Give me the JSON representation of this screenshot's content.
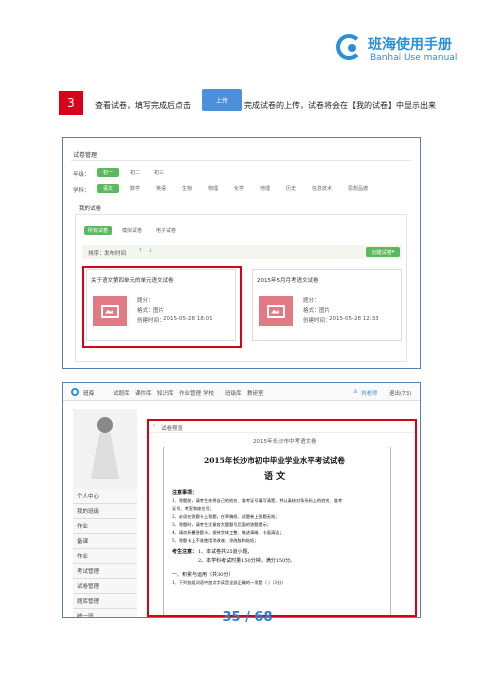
{
  "header": {
    "logo_cn": "班海使用手册",
    "logo_en": "Banhai Use manual"
  },
  "step": {
    "number": "3",
    "text_before": "查看试卷，填写完成后点击",
    "button_label": "上传",
    "text_after": "完成试卷的上传，试卷将会在【我的试卷】中显示出来"
  },
  "screenshot1": {
    "title": "试卷管理",
    "grade_label": "年级：",
    "grades": [
      "初一",
      "初二",
      "初三"
    ],
    "subject_label": "学科：",
    "subjects": [
      "语文",
      "数学",
      "英语",
      "生物",
      "物理",
      "化学",
      "地理",
      "历史",
      "信息技术",
      "思想品德"
    ],
    "section_label": "我的试卷",
    "tabs": [
      "所有试卷",
      "模拟试卷",
      "电子试卷"
    ],
    "sort_label": "排序：",
    "sort_value": "发布时间",
    "create_button": "创建试卷",
    "cards": [
      {
        "title": "关于语文第四单元的单元语文试卷",
        "score_label": "题分：",
        "format_label": "格式：",
        "format_value": "图片",
        "time_label": "创建时间：",
        "time_value": "2015-05-28 18:01"
      },
      {
        "title": "2015年5月月考语文试卷",
        "score_label": "题分：",
        "format_label": "格式：",
        "format_value": "图片",
        "time_label": "创建时间：",
        "time_value": "2015-05-28 12:33"
      }
    ]
  },
  "screenshot2": {
    "brand": "班海",
    "nav": [
      "试题库",
      "课件库",
      "知识库",
      "作业管理",
      "学校",
      "班级库",
      "教研室"
    ],
    "user": "刘老师",
    "logout": "退出(73)",
    "sidebar": [
      "个人中心",
      "我的班级",
      "作业",
      "备课",
      "作业",
      "考试管理",
      "试卷管理",
      "题库管理",
      "统一班"
    ],
    "breadcrumb": "试卷预览",
    "doc_header": "2015年长沙市中考语文卷",
    "doc_title": "2015年长沙市初中毕业学业水平考试试卷",
    "doc_subject": "语  文",
    "notice_title": "注意事项：",
    "notices": [
      "1、答题前，请考生先将自己的姓名、准考证号填写清楚，并认真核对条形码上的姓名、准考",
      "   证号、考室和座位号；",
      "2、必须在答题卡上答题，在草稿纸、试题卷上答题无效；",
      "3、答题时，请考生注意各大题题号后面的答题提示；",
      "4、请勿折叠答题卡，保持字体工整、笔迹清晰、卡面清洁；",
      "5、答题卡上不准使用涂改液、涂改胶和贴纸；"
    ],
    "exam_note_label": "考生注意：",
    "exam_note_1": "1、本试卷共25道小题，",
    "exam_note_2": "2、本学科考试时量150分钟，满分150分。",
    "section_one": "一、积累与运用（共30分）",
    "section_one_q": "1、下列各组词语中加点字读音全部正确的一项是（    ）（3分）"
  },
  "footer": {
    "page_current": "35",
    "page_sep": " / ",
    "page_total": "68"
  }
}
